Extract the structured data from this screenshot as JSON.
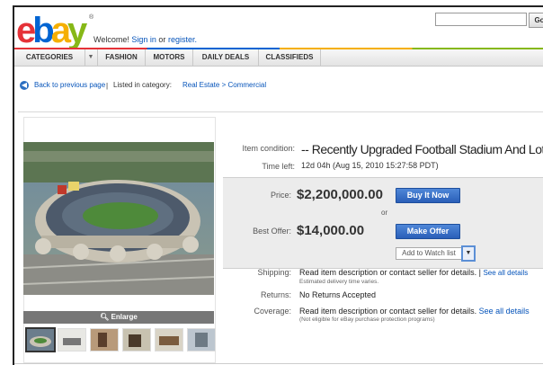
{
  "header": {
    "logo_text": "ebay",
    "trademark": "®",
    "welcome_prefix": "Welcome!",
    "sign_in": "Sign in",
    "or": "or",
    "register": "register.",
    "search_placeholder": "",
    "go_label": "Go"
  },
  "nav": {
    "categories": "CATEGORIES",
    "categories_arrow": "▼",
    "fashion": "FASHION",
    "motors": "MOTORS",
    "daily_deals": "DAILY DEALS",
    "classifieds": "CLASSIFIEDS"
  },
  "breadcrumb": {
    "back_label": "Back to previous page",
    "separator": "|",
    "listed_in": "Listed in category:",
    "category_path": "Real Estate > Commercial"
  },
  "gallery": {
    "enlarge_label": "Enlarge",
    "thumbnail_count": 6,
    "selected_thumbnail": 1
  },
  "item": {
    "condition_label": "Item condition:",
    "title": "-- Recently Upgraded Football Stadium And Lot For Sa",
    "time_left_label": "Time left:",
    "time_left_value": "12d 04h (Aug 15, 2010 15:27:58 PDT)",
    "price_label": "Price:",
    "price_value": "$2,200,000.00",
    "buy_now_label": "Buy It Now",
    "or_label": "or",
    "best_offer_label": "Best Offer:",
    "best_offer_value": "$14,000.00",
    "make_offer_label": "Make Offer",
    "watch_label": "Add to Watch list",
    "shipping_label": "Shipping:",
    "shipping_value": "Read item description or contact seller for details.",
    "shipping_sep": "|",
    "see_all_details": "See all details",
    "shipping_note": "Estimated delivery time varies.",
    "returns_label": "Returns:",
    "returns_value": "No Returns Accepted",
    "coverage_label": "Coverage:",
    "coverage_value": "Read item description or contact seller for details.",
    "coverage_link": "See all details",
    "coverage_note": "(Not eligible for eBay purchase protection programs)"
  },
  "colors": {
    "ebay_red": "#e53238",
    "ebay_blue": "#0064d2",
    "ebay_yellow": "#f5af02",
    "ebay_green": "#86b817",
    "link": "#0654ba",
    "button_blue": "#2a5fb8"
  }
}
